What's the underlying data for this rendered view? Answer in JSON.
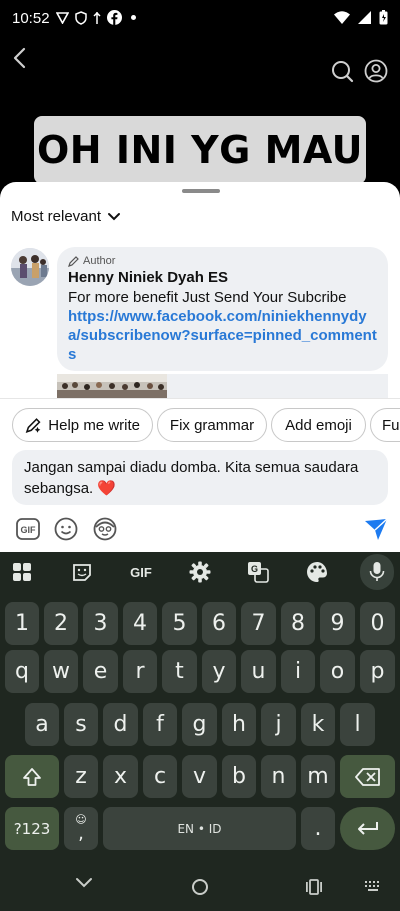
{
  "status_bar": {
    "time": "10:52"
  },
  "video": {
    "caption": "OH INI YG MAU"
  },
  "comments": {
    "sort_label": "Most relevant",
    "pinned": {
      "badge": "Author",
      "author_name": "Henny Niniek Dyah ES",
      "text": "For more benefit Just Send Your Subcribe",
      "link": "https://www.facebook.com/niniekhennydya/subscribenow?surface=pinned_comments"
    }
  },
  "suggestions": [
    "Help me write",
    "Fix grammar",
    "Add emoji",
    "Fu"
  ],
  "composer": {
    "text": "Jangan sampai diadu domba. Kita semua saudara sebangsa. ❤️"
  },
  "keyboard": {
    "toolbar_icons": [
      "grid-icon",
      "sticker-icon",
      "gif-icon",
      "settings-icon",
      "translate-icon",
      "palette-icon",
      "mic-icon"
    ],
    "gif_label": "GIF",
    "row_numbers": [
      "1",
      "2",
      "3",
      "4",
      "5",
      "6",
      "7",
      "8",
      "9",
      "0"
    ],
    "row1": [
      "q",
      "w",
      "e",
      "r",
      "t",
      "y",
      "u",
      "i",
      "o",
      "p"
    ],
    "row2": [
      "a",
      "s",
      "d",
      "f",
      "g",
      "h",
      "j",
      "k",
      "l"
    ],
    "row3": [
      "z",
      "x",
      "c",
      "v",
      "b",
      "n",
      "m"
    ],
    "symbols_label": "?123",
    "comma_label": ",",
    "emoji_hint": "☺",
    "space_label": "EN • ID",
    "period_label": "."
  },
  "colors": {
    "link": "#2979d6",
    "send": "#1d7bf0",
    "keyboard_bg": "#1f2720",
    "key": "#3b433d",
    "key_special": "#46593f"
  }
}
